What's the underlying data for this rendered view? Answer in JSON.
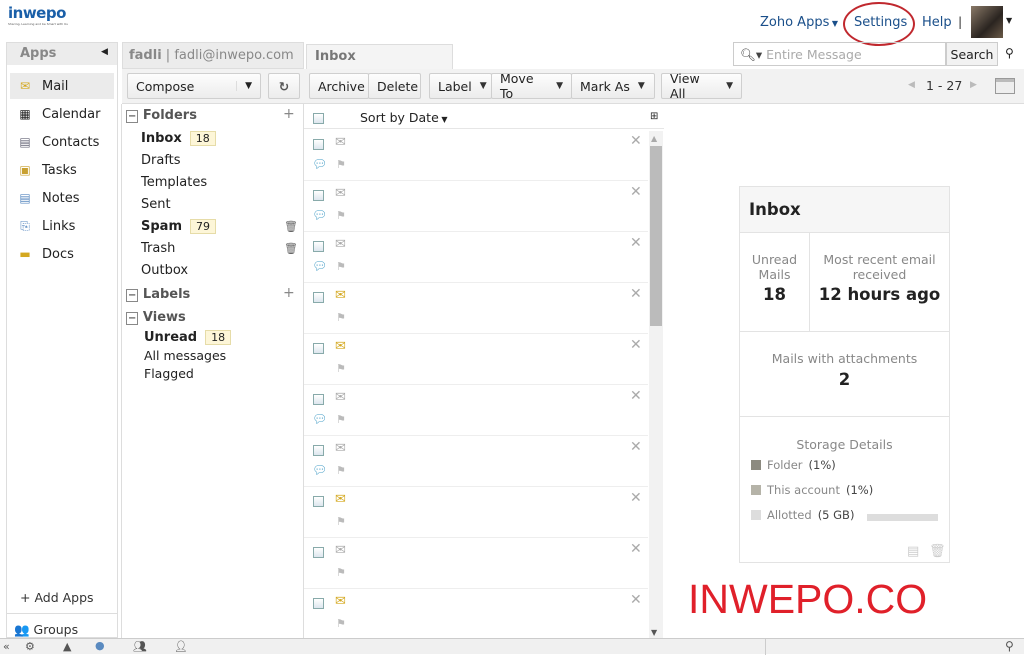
{
  "header": {
    "logo": "inwepo",
    "logo_tagline": "Sharing, Learning and be Smart with Us",
    "zoho_apps": "Zoho Apps",
    "settings": "Settings",
    "help": "Help",
    "separator": "|"
  },
  "apps_panel": {
    "title": "Apps",
    "items": [
      {
        "label": "Mail",
        "icon": "mail-icon"
      },
      {
        "label": "Calendar",
        "icon": "calendar-icon"
      },
      {
        "label": "Contacts",
        "icon": "contacts-icon"
      },
      {
        "label": "Tasks",
        "icon": "tasks-icon"
      },
      {
        "label": "Notes",
        "icon": "notes-icon"
      },
      {
        "label": "Links",
        "icon": "links-icon"
      },
      {
        "label": "Docs",
        "icon": "docs-icon"
      }
    ],
    "add_apps": "Add Apps",
    "groups": "Groups"
  },
  "account": {
    "name": "fadli",
    "separator": "|",
    "email": "fadli@inwepo.com"
  },
  "tab": "Inbox",
  "search": {
    "placeholder": "Entire Message",
    "button": "Search"
  },
  "toolbar": {
    "compose": "Compose",
    "archive": "Archive",
    "delete": "Delete",
    "label": "Label",
    "move_to": "Move To",
    "mark_as": "Mark As",
    "view_all": "View All",
    "pagination": "1 - 27"
  },
  "folders": {
    "title": "Folders",
    "items": [
      {
        "label": "Inbox",
        "count": "18",
        "bold": true
      },
      {
        "label": "Drafts"
      },
      {
        "label": "Templates"
      },
      {
        "label": "Sent"
      },
      {
        "label": "Spam",
        "count": "79",
        "bold": true
      },
      {
        "label": "Trash"
      },
      {
        "label": "Outbox"
      }
    ],
    "labels_title": "Labels",
    "views_title": "Views",
    "views": [
      {
        "label": "Unread",
        "count": "18"
      },
      {
        "label": "All messages"
      },
      {
        "label": "Flagged"
      }
    ]
  },
  "list": {
    "sort": "Sort by Date",
    "rows": [
      {
        "unread": false,
        "chat": true
      },
      {
        "unread": false,
        "chat": true
      },
      {
        "unread": false,
        "chat": true
      },
      {
        "unread": true,
        "chat": false
      },
      {
        "unread": true,
        "chat": false
      },
      {
        "unread": false,
        "chat": true
      },
      {
        "unread": false,
        "chat": true
      },
      {
        "unread": true,
        "chat": false
      },
      {
        "unread": false,
        "chat": false
      },
      {
        "unread": true,
        "chat": false
      }
    ]
  },
  "summary": {
    "title": "Inbox",
    "unread_label": "Unread Mails",
    "unread_value": "18",
    "recent_label": "Most recent email received",
    "recent_value": "12 hours ago",
    "attach_label": "Mails with attachments",
    "attach_value": "2",
    "storage_title": "Storage Details",
    "storage": [
      {
        "label": "Folder",
        "value": "(1%)",
        "color": "#8c8a80"
      },
      {
        "label": "This account",
        "value": "(1%)",
        "color": "#b5b3a8"
      },
      {
        "label": "Allotted",
        "value": "(5 GB)",
        "color": "#dddddd"
      }
    ]
  },
  "watermark": "INWEPO.CO",
  "colors": {
    "accent": "#1a4f8a",
    "watermark": "#e0202a",
    "highlight_circle": "#c0282e"
  }
}
